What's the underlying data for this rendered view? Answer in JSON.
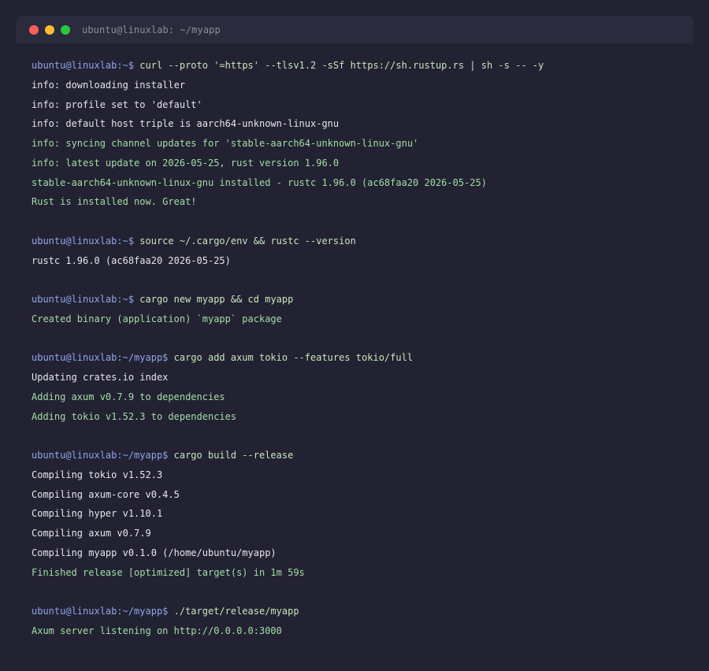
{
  "window": {
    "title": "ubuntu@linuxlab: ~/myapp"
  },
  "colors": {
    "background": "#222233",
    "titlebar": "#2a2b3c",
    "prompt": "#8fa6e8",
    "command": "#c8e6b8",
    "output": "#e6e6ea",
    "success": "#a3dea3"
  },
  "lines": [
    {
      "type": "cmd",
      "prompt": "ubuntu@linuxlab:~$",
      "text": " curl --proto '=https' --tlsv1.2 -sSf https://sh.rustup.rs | sh -s -- -y"
    },
    {
      "type": "out",
      "text": "info: downloading installer"
    },
    {
      "type": "out",
      "text": "info: profile set to 'default'"
    },
    {
      "type": "out",
      "text": "info: default host triple is aarch64-unknown-linux-gnu"
    },
    {
      "type": "ok",
      "text": "info: syncing channel updates for 'stable-aarch64-unknown-linux-gnu'"
    },
    {
      "type": "ok",
      "text": "info: latest update on 2026-05-25, rust version 1.96.0"
    },
    {
      "type": "ok",
      "text": "stable-aarch64-unknown-linux-gnu installed - rustc 1.96.0 (ac68faa20 2026-05-25)"
    },
    {
      "type": "ok",
      "text": "Rust is installed now. Great!"
    },
    {
      "type": "blank",
      "text": ""
    },
    {
      "type": "cmd",
      "prompt": "ubuntu@linuxlab:~$",
      "text": " source ~/.cargo/env && rustc --version"
    },
    {
      "type": "out",
      "text": "rustc 1.96.0 (ac68faa20 2026-05-25)"
    },
    {
      "type": "blank",
      "text": ""
    },
    {
      "type": "cmd",
      "prompt": "ubuntu@linuxlab:~$",
      "text": " cargo new myapp && cd myapp"
    },
    {
      "type": "ok",
      "text": "Created binary (application) `myapp` package"
    },
    {
      "type": "blank",
      "text": ""
    },
    {
      "type": "cmd",
      "prompt": "ubuntu@linuxlab:~/myapp$",
      "text": " cargo add axum tokio --features tokio/full"
    },
    {
      "type": "out",
      "text": "Updating crates.io index"
    },
    {
      "type": "ok",
      "text": "Adding axum v0.7.9 to dependencies"
    },
    {
      "type": "ok",
      "text": "Adding tokio v1.52.3 to dependencies"
    },
    {
      "type": "blank",
      "text": ""
    },
    {
      "type": "cmd",
      "prompt": "ubuntu@linuxlab:~/myapp$",
      "text": " cargo build --release"
    },
    {
      "type": "out",
      "text": "Compiling tokio v1.52.3"
    },
    {
      "type": "out",
      "text": "Compiling axum-core v0.4.5"
    },
    {
      "type": "out",
      "text": "Compiling hyper v1.10.1"
    },
    {
      "type": "out",
      "text": "Compiling axum v0.7.9"
    },
    {
      "type": "out",
      "text": "Compiling myapp v0.1.0 (/home/ubuntu/myapp)"
    },
    {
      "type": "ok",
      "text": "Finished release [optimized] target(s) in 1m 59s"
    },
    {
      "type": "blank",
      "text": ""
    },
    {
      "type": "cmd",
      "prompt": "ubuntu@linuxlab:~/myapp$",
      "text": " ./target/release/myapp"
    },
    {
      "type": "ok",
      "text": "Axum server listening on http://0.0.0.0:3000"
    }
  ]
}
